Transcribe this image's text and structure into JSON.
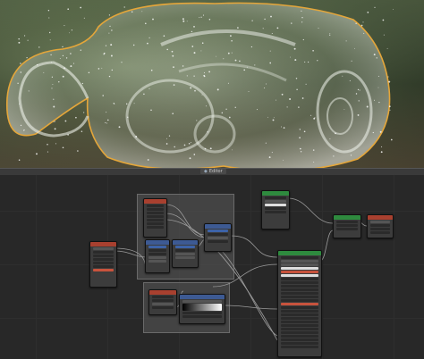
{
  "colors": {
    "glass": "#c9d4c2",
    "outline": "#e4a63a",
    "header_green": "#2e8a3e",
    "header_blue": "#3d5a93",
    "header_red": "#a8402f",
    "header_teal": "#2e6a6a",
    "link": "#9a9a9a"
  },
  "editor_label": {
    "icon": "node-tree-icon",
    "text": "Editor"
  }
}
